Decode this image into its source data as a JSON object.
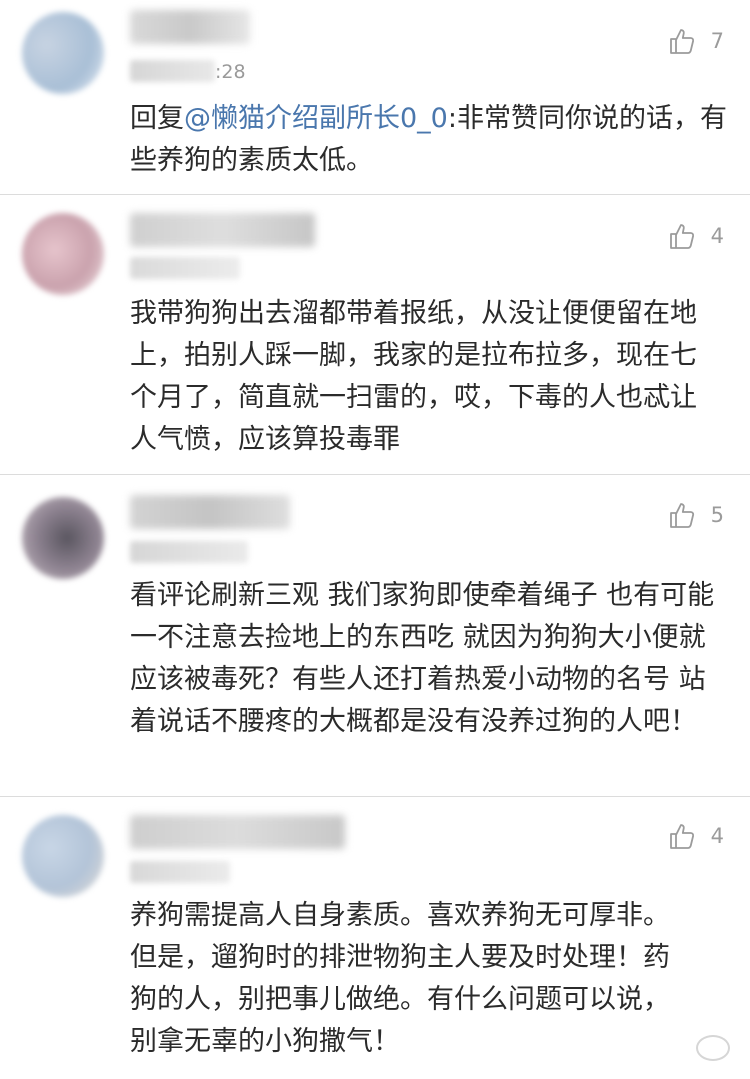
{
  "comments": [
    {
      "time": ":28",
      "likes": "7",
      "reply_prefix": "回复",
      "mention": "@懒猫介绍副所长0_0",
      "text": ":非常赞同你说的话，有些养狗的素质太低。"
    },
    {
      "likes": "4",
      "text": "我带狗狗出去溜都带着报纸，从没让便便留在地上，拍别人踩一脚，我家的是拉布拉多，现在七个月了，简直就一扫雷的，哎，下毒的人也忒让人气愤，应该算投毒罪"
    },
    {
      "likes": "5",
      "text": "看评论刷新三观 我们家狗即使牵着绳子 也有可能一不注意去捡地上的东西吃 就因为狗狗大小便就应该被毒死？有些人还打着热爱小动物的名号 站着说话不腰疼的大概都是没有没养过狗的人吧！"
    },
    {
      "likes": "4",
      "text": "养狗需提高人自身素质。喜欢养狗无可厚非。但是，遛狗时的排泄物狗主人要及时处理！药狗的人，别把事儿做绝。有什么问题可以说，别拿无辜的小狗撒气！"
    }
  ],
  "icons": {
    "like": "thumbs-up-icon"
  },
  "colors": {
    "mention": "#4a77ad",
    "text": "#2b2b2b",
    "meta": "#9b9b9b",
    "divider": "#dcdcdc"
  }
}
